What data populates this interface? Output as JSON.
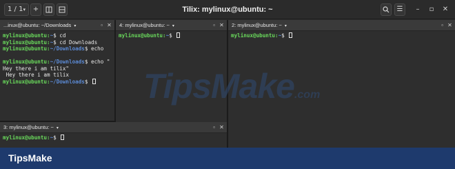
{
  "window": {
    "title": "Tilix: mylinux@ubuntu: ~",
    "session_indicator": "1 / 1",
    "session_dropdown_icon": "chevron-down-icon",
    "controls": [
      "search-icon",
      "menu-icon",
      "minimize-icon",
      "maximize-icon",
      "close-icon"
    ]
  },
  "panes": [
    {
      "title": "...inux@ubuntu: ~/Downloads",
      "lines": [
        {
          "user": "mylinux@ubuntu",
          "path": "~",
          "cmd": "cd"
        },
        {
          "user": "mylinux@ubuntu",
          "path": "~",
          "cmd": "cd Downloads"
        },
        {
          "user": "mylinux@ubuntu",
          "path": "~/Downloads",
          "cmd": "echo"
        },
        {
          "plain": ""
        },
        {
          "user": "mylinux@ubuntu",
          "path": "~/Downloads",
          "cmd": "echo \""
        },
        {
          "plain": "Hey there i am tilix\""
        },
        {
          "plain": " Hey there i am tilix"
        },
        {
          "user": "mylinux@ubuntu",
          "path": "~/Downloads",
          "cmd": "",
          "cursor": true
        }
      ]
    },
    {
      "title": "4: mylinux@ubuntu: ~",
      "lines": [
        {
          "user": "mylinux@ubuntu",
          "path": "~",
          "cmd": "",
          "cursor": true
        }
      ]
    },
    {
      "title": "2: mylinux@ubuntu: ~",
      "lines": [
        {
          "user": "mylinux@ubuntu",
          "path": "~",
          "cmd": "",
          "cursor": true
        }
      ]
    },
    {
      "title": "3: mylinux@ubuntu: ~",
      "lines": [
        {
          "user": "mylinux@ubuntu",
          "path": "~",
          "cmd": "",
          "cursor": true
        }
      ]
    }
  ],
  "watermark": {
    "text": "TipsMake",
    "suffix": ".com"
  },
  "brand": "TipsMake"
}
